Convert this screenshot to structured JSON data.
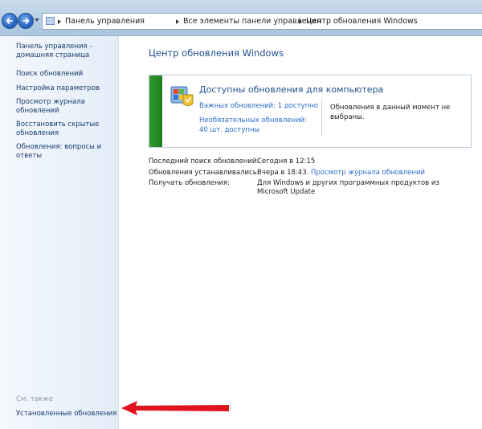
{
  "address_bar": {
    "crumbs": [
      "Панель управления",
      "Все элементы панели управления",
      "Центр обновления Windows"
    ]
  },
  "left_pane": {
    "links": [
      "Панель управления - домашняя страница",
      "Поиск обновлений",
      "Настройка параметров",
      "Просмотр журнала обновлений",
      "Восстановить скрытые обновления",
      "Обновления: вопросы и ответы"
    ],
    "see_also_label": "См. также",
    "installed_updates": "Установленные обновления"
  },
  "main": {
    "title": "Центр обновления Windows",
    "status": {
      "heading": "Доступны обновления для компьютера",
      "important_link": "Важных обновлений: 1 доступно",
      "optional_link": "Необязательных обновлений: 40 шт. доступны",
      "none_selected": "Обновления в данный момент не выбраны."
    },
    "info": {
      "last_search_label": "Последний поиск обновлений:",
      "last_search_value": "Сегодня в 12:15",
      "installed_label": "Обновления устанавливались:",
      "installed_value": "Вчера в 18:43.",
      "history_link": "Просмотр журнала обновлений",
      "receive_label": "Получать обновления:",
      "receive_value": "Для Windows и других программных продуктов из Microsoft Update"
    }
  },
  "colors": {
    "status_stripe": "#2f9a2f",
    "link": "#2a6bcc",
    "title": "#1e4e8c",
    "annotation_arrow": "#e0141e"
  }
}
